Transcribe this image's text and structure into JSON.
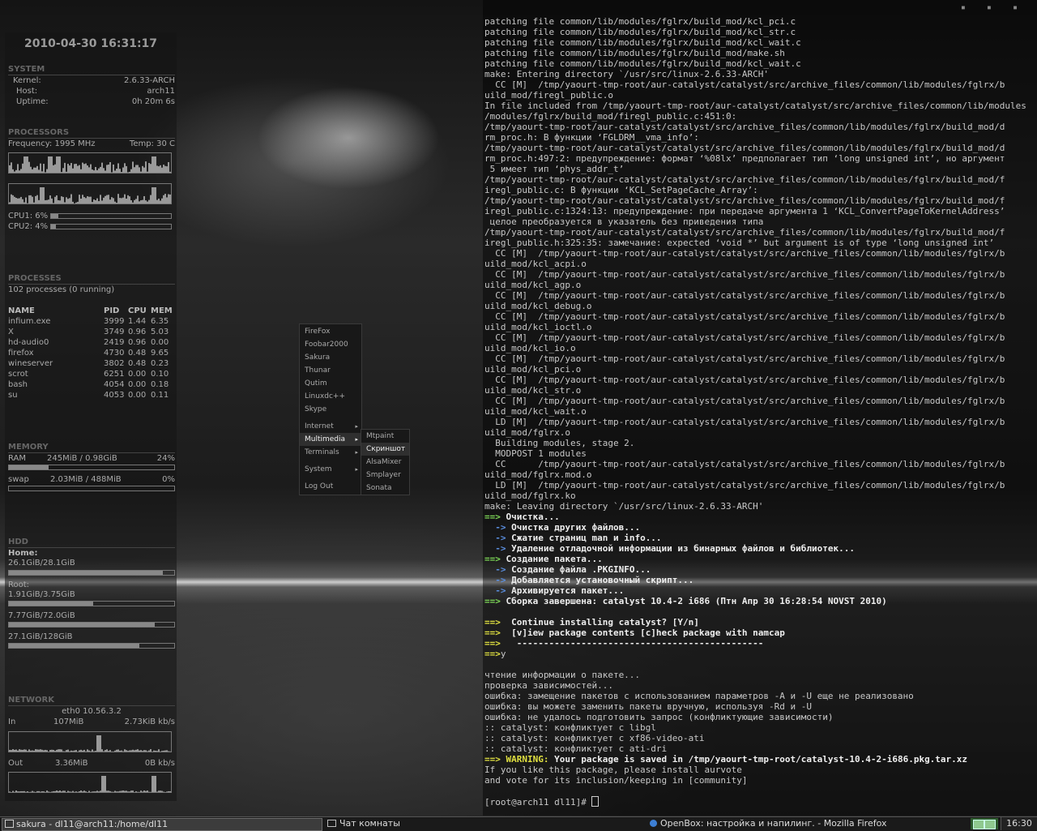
{
  "conky": {
    "datetime": "2010-04-30 16:31:17",
    "system": {
      "title": "SYSTEM",
      "kernel_label": "Kernel:",
      "kernel": "2.6.33-ARCH",
      "host_label": "Host:",
      "host": "arch11",
      "uptime_label": "Uptime:",
      "uptime": "0h 20m 6s"
    },
    "processors": {
      "title": "PROCESSORS",
      "frequency": "Frequency: 1995 MHz",
      "temp": "Temp: 30 C",
      "cpu1": "CPU1: 6%",
      "cpu2": "CPU2: 4%",
      "cpu1_pct": 6,
      "cpu2_pct": 4
    },
    "processes": {
      "title": "PROCESSES",
      "summary": "102 processes (0 running)",
      "headers": {
        "name": "NAME",
        "pid": "PID",
        "cpu": "CPU",
        "mem": "MEM"
      },
      "rows": [
        {
          "name": "infium.exe",
          "pid": "3999",
          "cpu": "1.44",
          "mem": "6.35"
        },
        {
          "name": "X",
          "pid": "3749",
          "cpu": "0.96",
          "mem": "5.03"
        },
        {
          "name": "hd-audio0",
          "pid": "2419",
          "cpu": "0.96",
          "mem": "0.00"
        },
        {
          "name": "firefox",
          "pid": "4730",
          "cpu": "0.48",
          "mem": "9.65"
        },
        {
          "name": "wineserver",
          "pid": "3802",
          "cpu": "0.48",
          "mem": "0.23"
        },
        {
          "name": "scrot",
          "pid": "6251",
          "cpu": "0.00",
          "mem": "0.10"
        },
        {
          "name": "bash",
          "pid": "4054",
          "cpu": "0.00",
          "mem": "0.18"
        },
        {
          "name": "su",
          "pid": "4053",
          "cpu": "0.00",
          "mem": "0.11"
        }
      ]
    },
    "memory": {
      "title": "MEMORY",
      "ram_label": "RAM",
      "ram": "245MiB / 0.98GiB",
      "ram_pct": "24%",
      "ram_pct_num": 24,
      "swap_label": "swap",
      "swap": "2.03MiB / 488MiB",
      "swap_pct": "0%",
      "swap_pct_num": 0
    },
    "hdd": {
      "title": "HDD",
      "home_label": "Home:",
      "home": "26.1GiB/28.1GiB",
      "home_pct": 93,
      "root_label": "Root:",
      "root": "1.91GiB/3.75GiB",
      "root_pct": 51,
      "d3": "7.77GiB/72.0GiB",
      "d3_pct": 88,
      "d4": "27.1GiB/128GiB",
      "d4_pct": 79
    },
    "network": {
      "title": "NETWORK",
      "iface": "eth0 10.56.3.2",
      "in_label": "In",
      "in_total": "107MiB",
      "in_rate": "2.73KiB kb/s",
      "out_label": "Out",
      "out_total": "3.36MiB",
      "out_rate": "0B  kb/s"
    }
  },
  "menu": {
    "items": [
      "FireFox",
      "Foobar2000",
      "Sakura",
      "Thunar",
      "Qutim",
      "Linuxdc++",
      "Skype"
    ],
    "submenus": [
      "Internet",
      "Multimedia",
      "Terminals",
      "System"
    ],
    "logout": "Log Out",
    "multimedia_items": [
      "Mtpaint",
      "Скриншот",
      "AlsaMixer",
      "Smplayer",
      "Sonata"
    ]
  },
  "terminal": {
    "lines": [
      "patching file common/lib/modules/fglrx/build_mod/kcl_pci.c",
      "patching file common/lib/modules/fglrx/build_mod/kcl_str.c",
      "patching file common/lib/modules/fglrx/build_mod/kcl_wait.c",
      "patching file common/lib/modules/fglrx/build_mod/make.sh",
      "patching file common/lib/modules/fglrx/build_mod/kcl_wait.c",
      "make: Entering directory `/usr/src/linux-2.6.33-ARCH'",
      "  CC [M]  /tmp/yaourt-tmp-root/aur-catalyst/catalyst/src/archive_files/common/lib/modules/fglrx/b",
      "uild_mod/firegl_public.o",
      "In file included from /tmp/yaourt-tmp-root/aur-catalyst/catalyst/src/archive_files/common/lib/modules",
      "/modules/fglrx/build_mod/firegl_public.c:451:0:",
      "/tmp/yaourt-tmp-root/aur-catalyst/catalyst/src/archive_files/common/lib/modules/fglrx/build_mod/d",
      "rm_proc.h: В функции ‘FGLDRM__vma_info’:",
      "/tmp/yaourt-tmp-root/aur-catalyst/catalyst/src/archive_files/common/lib/modules/fglrx/build_mod/d",
      "rm_proc.h:497:2: предупреждение: формат ‘%08lx’ предполагает тип ‘long unsigned int’, но аргумент",
      " 5 имеет тип ‘phys_addr_t’",
      "/tmp/yaourt-tmp-root/aur-catalyst/catalyst/src/archive_files/common/lib/modules/fglrx/build_mod/f",
      "iregl_public.c: В функции ‘KCL_SetPageCache_Array’:",
      "/tmp/yaourt-tmp-root/aur-catalyst/catalyst/src/archive_files/common/lib/modules/fglrx/build_mod/f",
      "iregl_public.c:1324:13: предупреждение: при передаче аргумента 1 ‘KCL_ConvertPageToKernelAddress’",
      " целое преобразуется в указатель без приведения типа",
      "/tmp/yaourt-tmp-root/aur-catalyst/catalyst/src/archive_files/common/lib/modules/fglrx/build_mod/f",
      "iregl_public.h:325:35: замечание: expected ‘void *’ but argument is of type ‘long unsigned int’",
      "  CC [M]  /tmp/yaourt-tmp-root/aur-catalyst/catalyst/src/archive_files/common/lib/modules/fglrx/b",
      "uild_mod/kcl_acpi.o",
      "  CC [M]  /tmp/yaourt-tmp-root/aur-catalyst/catalyst/src/archive_files/common/lib/modules/fglrx/b",
      "uild_mod/kcl_agp.o",
      "  CC [M]  /tmp/yaourt-tmp-root/aur-catalyst/catalyst/src/archive_files/common/lib/modules/fglrx/b",
      "uild_mod/kcl_debug.o",
      "  CC [M]  /tmp/yaourt-tmp-root/aur-catalyst/catalyst/src/archive_files/common/lib/modules/fglrx/b",
      "uild_mod/kcl_ioctl.o",
      "  CC [M]  /tmp/yaourt-tmp-root/aur-catalyst/catalyst/src/archive_files/common/lib/modules/fglrx/b",
      "uild_mod/kcl_io.o",
      "  CC [M]  /tmp/yaourt-tmp-root/aur-catalyst/catalyst/src/archive_files/common/lib/modules/fglrx/b",
      "uild_mod/kcl_pci.o",
      "  CC [M]  /tmp/yaourt-tmp-root/aur-catalyst/catalyst/src/archive_files/common/lib/modules/fglrx/b",
      "uild_mod/kcl_str.o",
      "  CC [M]  /tmp/yaourt-tmp-root/aur-catalyst/catalyst/src/archive_files/common/lib/modules/fglrx/b",
      "uild_mod/kcl_wait.o",
      "  LD [M]  /tmp/yaourt-tmp-root/aur-catalyst/catalyst/src/archive_files/common/lib/modules/fglrx/b",
      "uild_mod/fglrx.o",
      "  Building modules, stage 2.",
      "  MODPOST 1 modules",
      "  CC      /tmp/yaourt-tmp-root/aur-catalyst/catalyst/src/archive_files/common/lib/modules/fglrx/b",
      "uild_mod/fglrx.mod.o",
      "  LD [M]  /tmp/yaourt-tmp-root/aur-catalyst/catalyst/src/archive_files/common/lib/modules/fglrx/b",
      "uild_mod/fglrx.ko",
      "make: Leaving directory `/usr/src/linux-2.6.33-ARCH'"
    ],
    "colored": [
      {
        "p": "==> ",
        "pc": "#7ed957",
        "t": "Очистка...",
        "b": true
      },
      {
        "p": "  -> ",
        "pc": "#5b8fe0",
        "t": "Очистка других файлов...",
        "b": true
      },
      {
        "p": "  -> ",
        "pc": "#5b8fe0",
        "t": "Сжатие страниц man и info...",
        "b": true
      },
      {
        "p": "  -> ",
        "pc": "#5b8fe0",
        "t": "Удаление отладочной информации из бинарных файлов и библиотек...",
        "b": true
      },
      {
        "p": "==> ",
        "pc": "#7ed957",
        "t": "Создание пакета...",
        "b": true
      },
      {
        "p": "  -> ",
        "pc": "#5b8fe0",
        "t": "Создание файла .PKGINFO...",
        "b": true
      },
      {
        "p": "  -> ",
        "pc": "#5b8fe0",
        "t": "Добавляется установочный скрипт...",
        "b": true
      },
      {
        "p": "  -> ",
        "pc": "#5b8fe0",
        "t": "Архивируется пакет...",
        "b": true
      },
      {
        "p": "==> ",
        "pc": "#7ed957",
        "t": "Сборка завершена: catalyst 10.4-2 i686 (Птн Апр 30 16:28:54 NOVST 2010)",
        "b": true
      },
      {
        "p": "",
        "pc": "#ccc",
        "t": "",
        "b": false
      },
      {
        "p": "==>  ",
        "pc": "#e0e040",
        "t": "Continue installing catalyst? [Y/n]",
        "b": true
      },
      {
        "p": "==>  ",
        "pc": "#e0e040",
        "t": "[v]iew package contents [c]heck package with namcap",
        "b": true
      },
      {
        "p": "==>  ",
        "pc": "#e0e040",
        "t": " ----------------------------------------------",
        "b": true
      },
      {
        "p": "==>",
        "pc": "#e0e040",
        "t": "y",
        "b": false
      },
      {
        "p": "",
        "pc": "#ccc",
        "t": "",
        "b": false
      },
      {
        "p": "",
        "pc": "#ccc",
        "t": "чтение информации о пакете...",
        "b": false
      },
      {
        "p": "",
        "pc": "#ccc",
        "t": "проверка зависимостей...",
        "b": false
      },
      {
        "p": "",
        "pc": "#ccc",
        "t": "ошибка: замещение пакетов с использованием параметров -A и -U еще не реализовано",
        "b": false
      },
      {
        "p": "",
        "pc": "#ccc",
        "t": "ошибка: вы можете заменить пакеты вручную, используя -Rd и -U",
        "b": false
      },
      {
        "p": "",
        "pc": "#ccc",
        "t": "ошибка: не удалось подготовить запрос (конфликтующие зависимости)",
        "b": false
      },
      {
        "p": "",
        "pc": "#ccc",
        "t": ":: catalyst: конфликтует с libgl",
        "b": false
      },
      {
        "p": "",
        "pc": "#ccc",
        "t": ":: catalyst: конфликтует с xf86-video-ati",
        "b": false
      },
      {
        "p": "",
        "pc": "#ccc",
        "t": ":: catalyst: конфликтует с ati-dri",
        "b": false
      },
      {
        "p": "==> ",
        "pc": "#e0e040",
        "w": "WARNING:",
        "t": " Your package is saved in /tmp/yaourt-tmp-root/catalyst-10.4-2-i686.pkg.tar.xz",
        "b": true
      },
      {
        "p": "",
        "pc": "#ccc",
        "t": "If you like this package, please install aurvote",
        "b": false
      },
      {
        "p": "",
        "pc": "#ccc",
        "t": "and vote for its inclusion/keeping in [community]",
        "b": false
      },
      {
        "p": "",
        "pc": "#ccc",
        "t": "",
        "b": false
      }
    ],
    "prompt": "[root@arch11 dl11]# ",
    "controls": "▪ ▪ ▪"
  },
  "taskbar": {
    "tasks": [
      {
        "label": "sakura - dl11@arch11:/home/dl11",
        "active": true
      },
      {
        "label": "Чат комнаты",
        "active": false
      },
      {
        "label": "OpenBox: настройка и напилинг. - Mozilla Firefox",
        "active": false
      }
    ],
    "clock": "16:30"
  },
  "colors": {
    "accent_green": "#7ed957",
    "accent_blue": "#5b8fe0",
    "accent_yellow": "#e0e040"
  },
  "icons": {
    "terminal_task": "terminal-icon",
    "chat_task": "chat-icon",
    "firefox_task": "firefox-icon",
    "tray": "network-tray-icon"
  }
}
